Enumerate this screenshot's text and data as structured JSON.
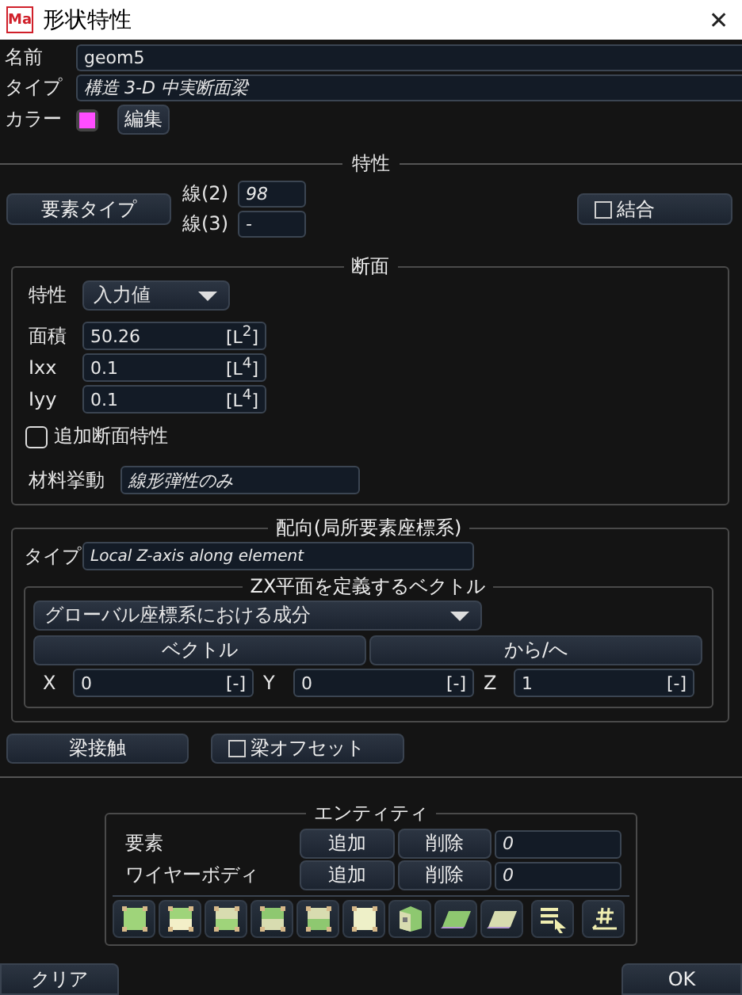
{
  "window": {
    "title": "形状特性",
    "app_badge": "Ma",
    "close": "✕"
  },
  "name": {
    "label": "名前",
    "value": "geom5"
  },
  "type": {
    "label": "タイプ",
    "value": "構造 3-D 中実断面梁"
  },
  "color": {
    "label": "カラー",
    "color": "#ff4dff",
    "edit_button": "編集"
  },
  "properties": {
    "title": "特性",
    "element_type_button": "要素タイプ",
    "lines": [
      {
        "label": "線(2)",
        "value": "98"
      },
      {
        "label": "線(3)",
        "value": "-"
      }
    ],
    "combine": {
      "label": "結合",
      "checked": false
    }
  },
  "section": {
    "title": "断面",
    "property": {
      "label": "特性",
      "value": "入力値"
    },
    "fields": [
      {
        "label": "面積",
        "value": "50.26",
        "unit": "[L$^{2}$]"
      },
      {
        "label": "Ixx",
        "value": "0.1",
        "unit": "[L$^{4}$]"
      },
      {
        "label": "Iyy",
        "value": "0.1",
        "unit": "[L$^{4}$]"
      }
    ],
    "additional": {
      "label": "追加断面特性",
      "checked": false
    },
    "material": {
      "label": "材料挙動",
      "value": "線形弾性のみ"
    }
  },
  "orientation": {
    "title": "配向(局所要素座標系)",
    "type": {
      "label": "タイプ",
      "value": "Local Z-axis along element"
    },
    "vector_group": {
      "title": "ZX平面を定義するベクトル",
      "mode": "グローバル座標系における成分",
      "tabs": [
        {
          "label": "ベクトル"
        },
        {
          "label": "から/へ"
        }
      ],
      "components": [
        {
          "label": "X",
          "value": "0",
          "unit": "[-]"
        },
        {
          "label": "Y",
          "value": "0",
          "unit": "[-]"
        },
        {
          "label": "Z",
          "value": "1",
          "unit": "[-]"
        }
      ]
    }
  },
  "beam_contact_button": "梁接触",
  "beam_offset": {
    "label": "梁オフセット",
    "checked": false
  },
  "entities": {
    "title": "エンティティ",
    "rows": [
      {
        "label": "要素",
        "add": "追加",
        "remove": "削除",
        "value": "0"
      },
      {
        "label": "ワイヤーボディ",
        "add": "追加",
        "remove": "削除",
        "value": "0"
      }
    ]
  },
  "buttons": {
    "clear": "クリア",
    "ok": "OK"
  }
}
